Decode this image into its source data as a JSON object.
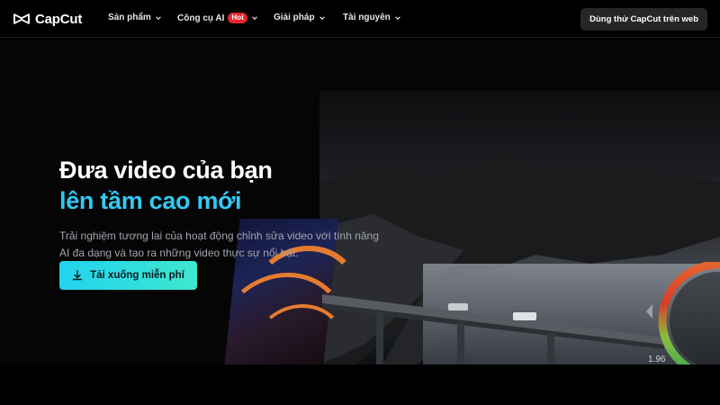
{
  "brand": {
    "name": "CapCut"
  },
  "nav": {
    "items": [
      {
        "label": "Sản phẩm",
        "has_dropdown": true
      },
      {
        "label": "Công cụ AI",
        "badge": "Hot",
        "has_dropdown": true
      },
      {
        "label": "Giải pháp",
        "has_dropdown": true
      },
      {
        "label": "Tài nguyên",
        "has_dropdown": true
      }
    ],
    "cta_label": "Dùng thử CapCut trên web"
  },
  "hero": {
    "title_line1": "Đưa video của bạn",
    "title_line2": "lên tầm cao mới",
    "description": "Trải nghiệm tương lai của hoạt động chỉnh sửa video với tính năng AI đa dạng và tạo ra những video thực sự nổi bật.",
    "download_label": "Tải xuống miễn phí",
    "download_icon": "download-icon",
    "accent_color": "#33c9f2",
    "button_gradient": [
      "#22d3ee",
      "#3ee7cf"
    ]
  },
  "visual": {
    "readout_value": "1.96"
  }
}
